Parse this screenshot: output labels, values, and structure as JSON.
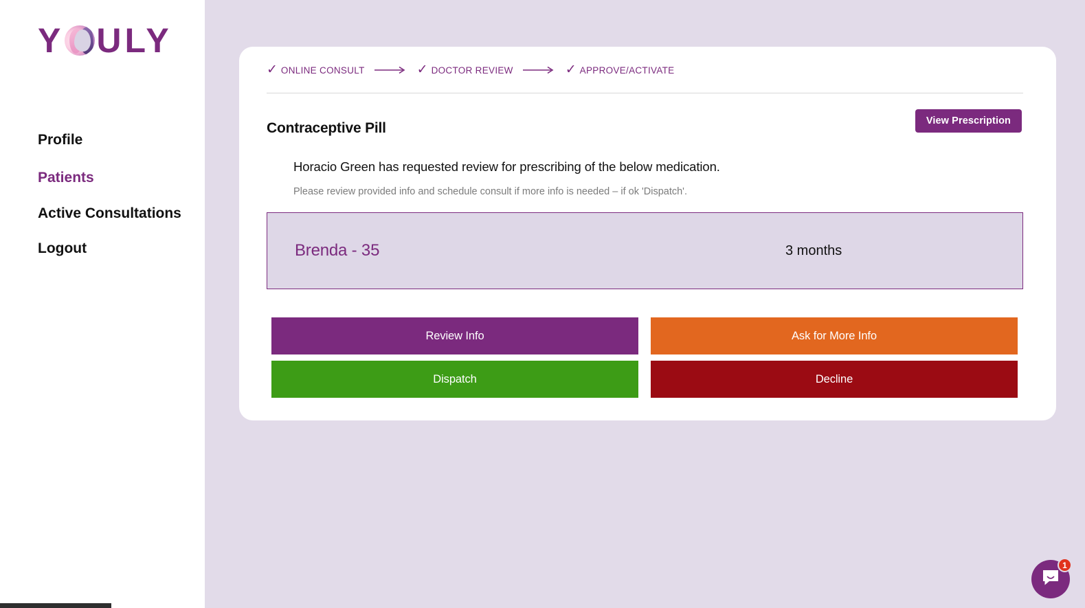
{
  "theme": {
    "brand_purple": "#7b2a7e",
    "page_background": "#e2dbe9",
    "card_background": "#ffffff",
    "med_card_background": "#ded7e7",
    "orange": "#e2671f",
    "green": "#3d9c16",
    "red": "#9b0b13",
    "badge_red": "#e1321c"
  },
  "sidebar": {
    "logo": {
      "text_before": "Y",
      "text_after": "ULY",
      "mark": "woman-face-circle-icon",
      "alt": "YOULY"
    },
    "items": [
      {
        "label": "Profile",
        "active": false
      },
      {
        "label": "Patients",
        "active": true
      },
      {
        "label": "Active Consultations",
        "active": false
      },
      {
        "label": "Logout",
        "active": false
      }
    ]
  },
  "stepper": {
    "check_glyph": "✓",
    "steps": [
      {
        "label": "ONLINE CONSULT",
        "complete": true
      },
      {
        "label": "DOCTOR REVIEW",
        "complete": true
      },
      {
        "label": "APPROVE/ACTIVATE",
        "complete": true
      }
    ]
  },
  "main": {
    "title": "Contraceptive Pill",
    "view_prescription_label": "View Prescription",
    "lead_text": "Horacio Green has requested review for prescribing of the below medication.",
    "sub_text": "Please review provided info and schedule consult if more info is needed – if ok 'Dispatch'.",
    "medication": {
      "name": "Brenda - 35",
      "duration": "3 months"
    },
    "actions": [
      {
        "label": "Review Info",
        "color": "#7b2a7e"
      },
      {
        "label": "Ask for More Info",
        "color": "#e2671f"
      },
      {
        "label": "Dispatch",
        "color": "#3d9c16"
      },
      {
        "label": "Decline",
        "color": "#9b0b13"
      }
    ]
  },
  "chat": {
    "icon": "chat-smile-icon",
    "unread_count": "1"
  }
}
